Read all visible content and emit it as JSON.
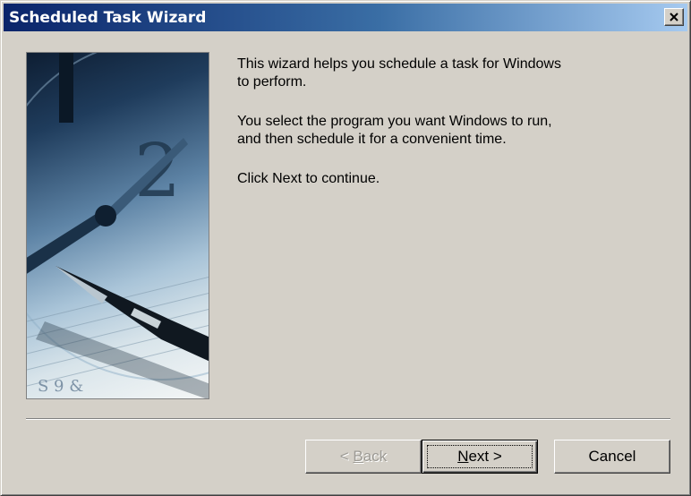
{
  "window": {
    "title": "Scheduled Task Wizard"
  },
  "icons": {
    "close": "close-icon",
    "illustration": "clock-and-pen-illustration"
  },
  "content": {
    "paragraph1": [
      "This wizard helps you schedule a task for Windows",
      "to perform."
    ],
    "paragraph2": [
      "You select the program you want Windows to run,",
      "and then schedule it for a convenient time."
    ],
    "paragraph3": [
      "Click Next to continue."
    ]
  },
  "buttons": {
    "back": {
      "prefix": "< ",
      "mnemonic": "B",
      "rest": "ack",
      "enabled": false
    },
    "next": {
      "mnemonic": "N",
      "rest": "ext >",
      "enabled": true,
      "default": true
    },
    "cancel": {
      "label": "Cancel",
      "enabled": true
    }
  },
  "colors": {
    "face": "#d4d0c8",
    "title_start": "#0a246a",
    "title_end": "#a6caf0"
  }
}
